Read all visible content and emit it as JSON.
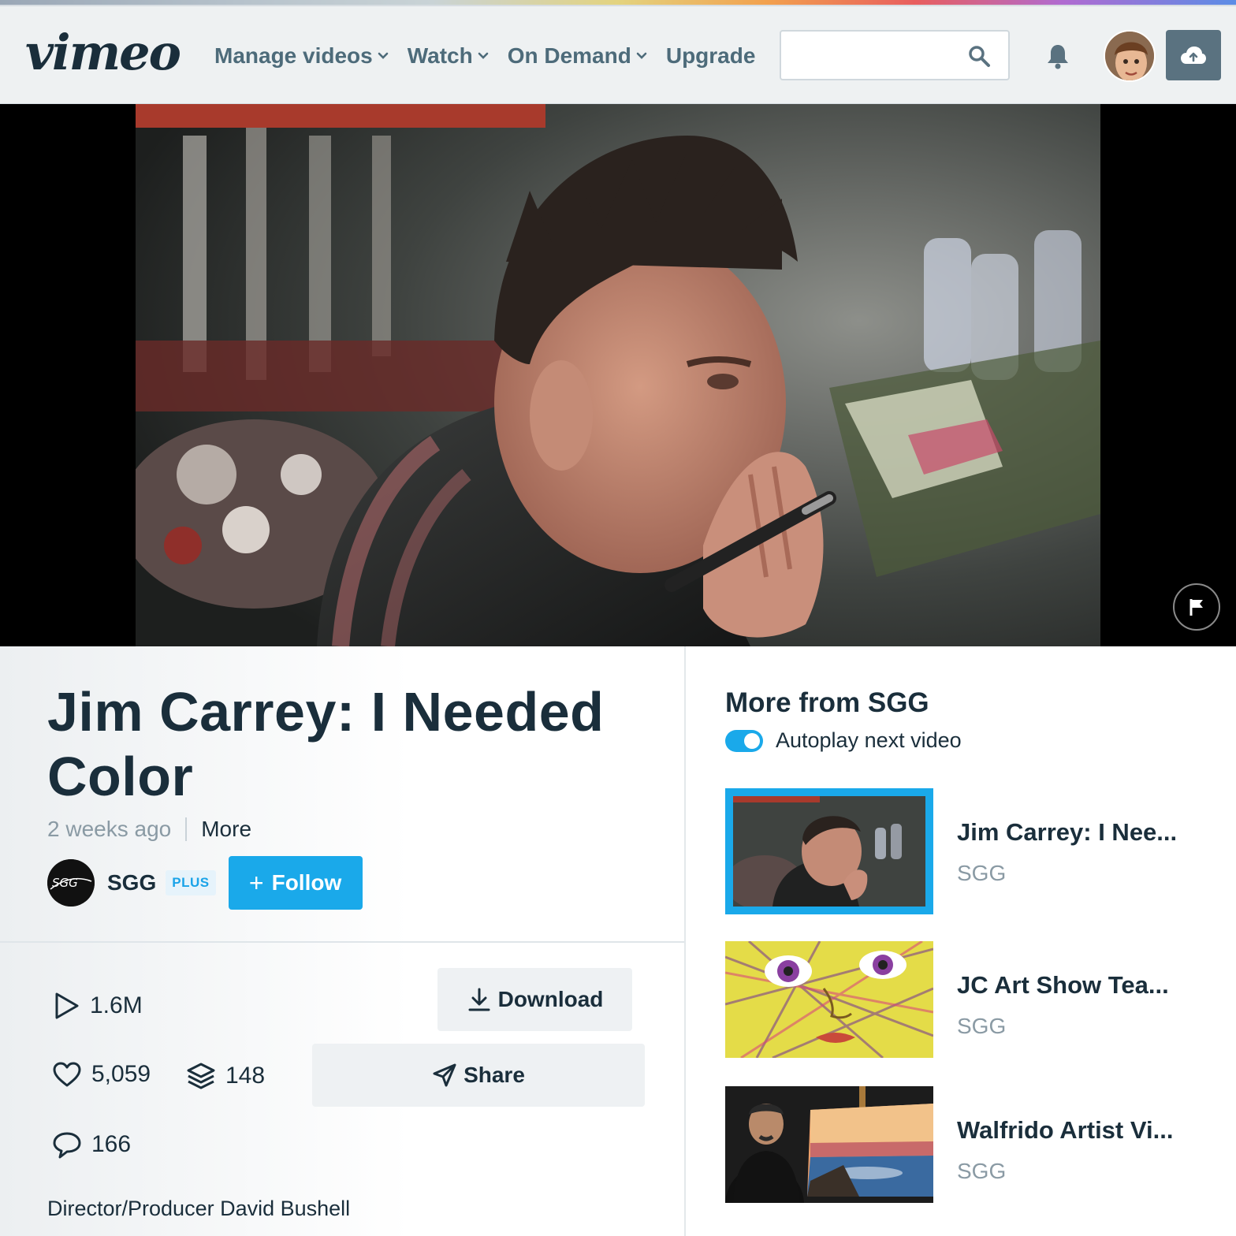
{
  "header": {
    "logo_text": "vimeo",
    "nav": [
      {
        "label": "Manage videos",
        "has_dropdown": true
      },
      {
        "label": "Watch",
        "has_dropdown": true
      },
      {
        "label": "On Demand",
        "has_dropdown": true
      },
      {
        "label": "Upgrade",
        "has_dropdown": false
      }
    ],
    "search": {
      "placeholder": "",
      "value": ""
    },
    "icons": [
      "search-icon",
      "bell-icon",
      "avatar",
      "upload-cloud-icon"
    ]
  },
  "video": {
    "title": "Jim Carrey: I Needed Color",
    "uploaded": "2 weeks ago",
    "more_label": "More",
    "owner": {
      "name": "SGG",
      "badge": "PLUS",
      "follow_label": "Follow"
    },
    "stats": {
      "plays": "1.6M",
      "likes": "5,059",
      "collections": "148",
      "comments": "166"
    },
    "download_label": "Download",
    "share_label": "Share",
    "credits": "Director/Producer David Bushell"
  },
  "sidebar": {
    "title": "More from SGG",
    "autoplay_label": "Autoplay next video",
    "autoplay_on": true,
    "items": [
      {
        "title": "Jim Carrey: I Nee...",
        "owner": "SGG",
        "active": true
      },
      {
        "title": "JC Art Show Tea...",
        "owner": "SGG",
        "active": false
      },
      {
        "title": "Walfrido Artist Vi...",
        "owner": "SGG",
        "active": false
      }
    ]
  },
  "colors": {
    "accent": "#1aa9ea",
    "text": "#1a2e3b",
    "muted": "#8a9aa4",
    "nav": "#4d6b7a"
  }
}
